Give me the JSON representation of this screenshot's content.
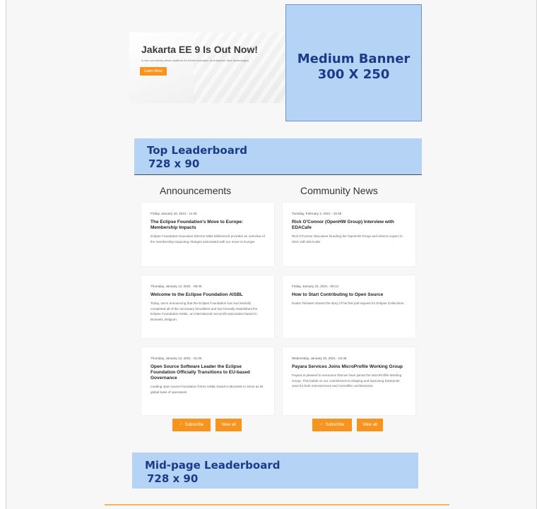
{
  "hero": {
    "title": "Jakarta EE 9 Is Out Now!",
    "subtitle": "A new community-driven platform for future innovation of enterprise Java technologies",
    "button_label": "Learn More"
  },
  "ads": {
    "medium_banner": {
      "line1": "Medium Banner",
      "line2": "300 X 250"
    },
    "top_leaderboard": {
      "line1": "Top Leaderboard",
      "line2": "728 x 90"
    },
    "mid_leaderboard": {
      "line1": "Mid-page Leaderboard",
      "line2": "728 x 90"
    }
  },
  "announcements": {
    "heading": "Announcements",
    "items": [
      {
        "date": "Friday, January 15, 2021 - 11:25",
        "title": "The Eclipse Foundation's Move to Europe: Membership Impacts",
        "desc": "Eclipse Foundation Executive Director Mike Milinkovich provides an overview of the membership-impacting changes associated with our move to Europe."
      },
      {
        "date": "Thursday, January 14, 2021 - 09:40",
        "title": "Welcome to the Eclipse Foundation AISBL",
        "desc": "Today, we're announcing that the Eclipse Foundation has successfully completed all of the necessary formalities and has formally established the Eclipse Foundation AISBL, an international non-profit association based in Brussels, Belgium."
      },
      {
        "date": "Thursday, January 14, 2021 - 01:00",
        "title": "Open Source Software Leader the Eclipse Foundation Officially Transitions to EU-based Governance",
        "desc": "Leading open source foundation forms AISBL based in Brussels to serve as its global base of operations."
      }
    ],
    "subscribe_label": "Subscribe",
    "view_all_label": "View all"
  },
  "community_news": {
    "heading": "Community News",
    "items": [
      {
        "date": "Tuesday, February 2, 2021 - 10:48",
        "title": "Rick O'Connor (OpenHW Group) Interview with EDACafe",
        "desc": "Rick O'Connor discusses founding the OpenHW Group and what to expect in 2021 with EDACafe."
      },
      {
        "date": "Friday, January 22, 2021 - 09:14",
        "title": "How to Start Contributing to Open Source",
        "desc": "Dustin Teirsaert shares the story of his first pull request for Eclipse Collections."
      },
      {
        "date": "Wednesday, January 20, 2021 - 04:46",
        "title": "Payara Services Joins MicroProfile Working Group",
        "desc": "Payara is pleased to announce that we have joined the MicroProfile Working Group. This builds on our commitment to shaping and improving Enterprise Java for both microservices and monolithic architectures."
      }
    ],
    "subscribe_label": "Subscribe",
    "view_all_label": "View all"
  },
  "icons": {
    "rss": "rss-icon"
  },
  "colors": {
    "accent": "#f7941d",
    "ad_fill": "#b5d3f5",
    "ad_text": "#1b3b8a"
  }
}
